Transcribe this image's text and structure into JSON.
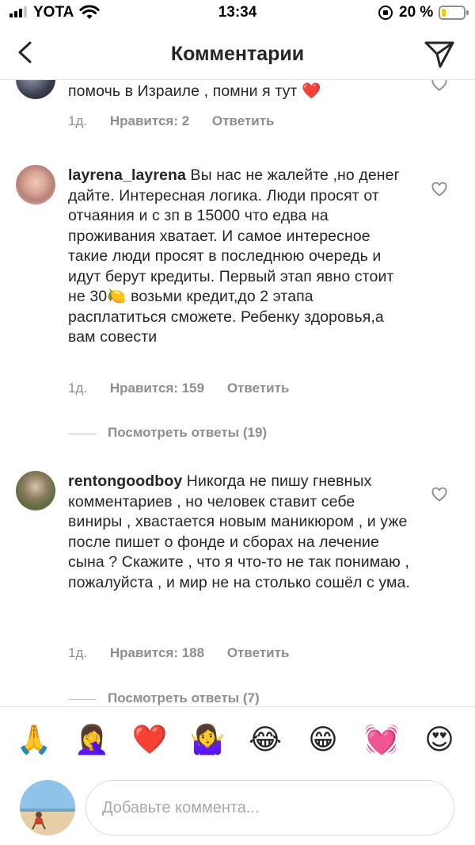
{
  "status_bar": {
    "carrier": "YOTA",
    "time": "13:34",
    "battery_percent": "20 %",
    "battery_level": 0.2,
    "battery_color": "#f5c518",
    "icons": [
      "signal-icon",
      "wifi-icon",
      "orientation-lock-icon",
      "battery-icon"
    ]
  },
  "nav": {
    "title": "Комментарии",
    "back_icon": "chevron-left-icon",
    "dm_icon": "paper-plane-icon"
  },
  "comments": [
    {
      "user": "",
      "text": "помочь в Израиле , помни я тут ❤️",
      "age": "1д.",
      "likes": "Нравится: 2",
      "reply": "Ответить"
    },
    {
      "user": "layrena_layrena",
      "text": " Вы нас не жалейте ,но денег дайте. Интересная  логика. Люди просят от отчаяния и с зп в 15000 что едва на проживания хватает. И самое интересное такие люди просят в последнюю очередь и идут берут кредиты. Первый этап явно стоит не 30🍋 возьми кредит,до 2 этапа расплатиться сможете. Ребенку здоровья,а вам совести",
      "age": "1д.",
      "likes": "Нравится: 159",
      "reply": "Ответить",
      "replies_label": "Посмотреть ответы (19)"
    },
    {
      "user": "rentongoodboy",
      "text": " Никогда не пишу гневных комментариев , но человек ставит себе виниры , хвастается новым маникюром , и уже после пишет о фонде и сборах на лечение сына ? Скажите , что я что-то не так понимаю , пожалуйста , и мир не на столько сошёл с ума.",
      "age": "1д.",
      "likes": "Нравится: 188",
      "reply": "Ответить",
      "replies_label": "Посмотреть ответы (7)"
    }
  ],
  "emoji_bar": [
    "🙏",
    "🤦‍♀️",
    "❤️",
    "🤷‍♀️",
    "😂",
    "😁",
    "💓",
    "😍"
  ],
  "input": {
    "placeholder": "Добавьте коммента..."
  }
}
